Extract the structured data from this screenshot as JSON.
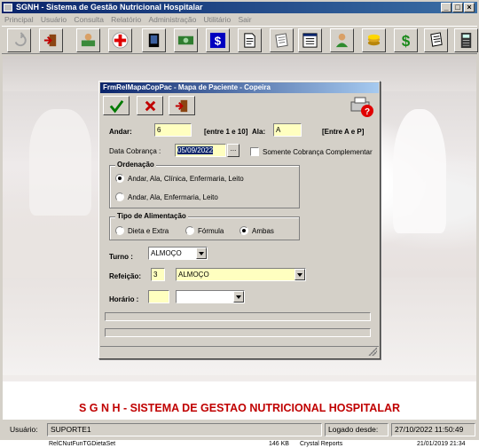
{
  "window": {
    "title": "SGNH - Sistema de Gestão Nutricional Hospitalar"
  },
  "menu": [
    "Principal",
    "Usuário",
    "Consulta",
    "Relatório",
    "Administração",
    "Utilitário",
    "Sair"
  ],
  "dialog": {
    "title": "FrmRelMapaCopPac - Mapa de Paciente - Copeira",
    "andar": {
      "label": "Andar:",
      "value": "6",
      "hint": "[entre 1 e 10]"
    },
    "ala": {
      "label": "Ala:",
      "value": "A",
      "hint": "[Entre A e P]"
    },
    "data_cobranca": {
      "label": "Data Cobrança :",
      "value": "05/09/2022",
      "button": "..."
    },
    "somente_cobranca": {
      "label": "Somente Cobrança Complementar",
      "checked": false
    },
    "ordenacao": {
      "title": "Ordenação",
      "options": [
        "Andar, Ala, Clínica, Enfermaria, Leito",
        "Andar, Ala, Enfermaria, Leito"
      ],
      "selected": 0
    },
    "tipo_alimentacao": {
      "title": "Tipo de Alimentação",
      "options": [
        "Dieta e Extra",
        "Fórmula",
        "Ambas"
      ],
      "selected": 2
    },
    "turno": {
      "label": "Turno :",
      "value": "ALMOÇO"
    },
    "refeicao": {
      "label": "Refeição:",
      "code": "3",
      "value": "ALMOÇO"
    },
    "horario": {
      "label": "Horário :",
      "value": ""
    }
  },
  "banner": "S G N H  - SISTEMA DE GESTAO NUTRICIONAL HOSPITALAR",
  "statusbar": {
    "user_label": "Usuário:",
    "user_value": "SUPORTE1",
    "login_label": "Logado desde:",
    "login_value": "27/10/2022  11:50:49"
  },
  "taskbar_strip": {
    "file": "RelCNutFunTGDietaSet",
    "size": "146 KB",
    "type": "Crystal Reports",
    "date": "21/01/2019 21:34"
  },
  "colors": {
    "title_blue": "#0a246a",
    "banner_red": "#c00000",
    "field_yellow": "#ffffc0",
    "selection": "#0a246a"
  }
}
